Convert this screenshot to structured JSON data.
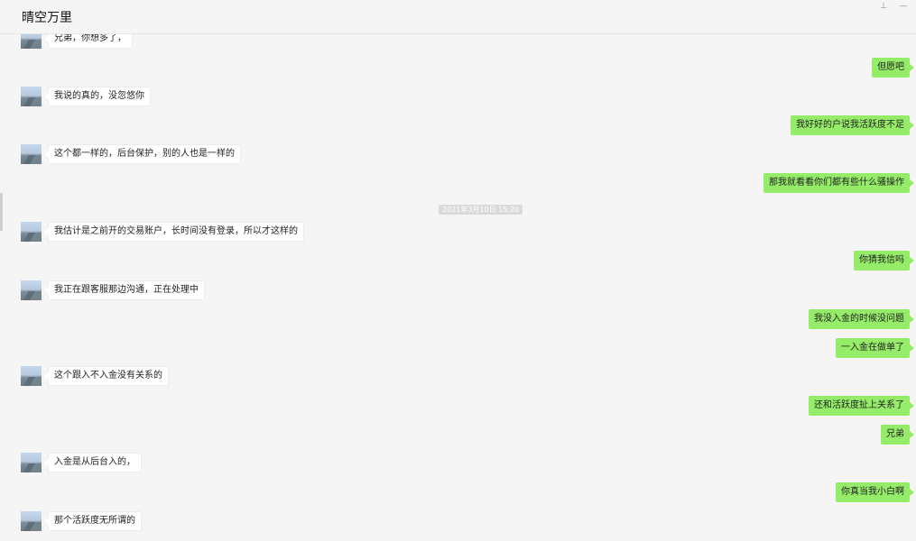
{
  "window": {
    "title": "晴空万里",
    "pin_icon": "pin-icon",
    "minimize_icon": "minimize-icon"
  },
  "chat": {
    "timestamp": "2021年3月10日 15:20",
    "messages": [
      {
        "side": "in",
        "text": "兄弟，你想多了，"
      },
      {
        "side": "out",
        "text": "但愿吧"
      },
      {
        "side": "in",
        "text": "我说的真的，没忽悠你"
      },
      {
        "side": "out",
        "text": "我好好的户说我活跃度不足"
      },
      {
        "side": "in",
        "text": "这个都一样的，后台保护，别的人也是一样的"
      },
      {
        "side": "out",
        "text": "那我就看看你们都有些什么骚操作"
      },
      {
        "side": "in",
        "text": "我估计是之前开的交易账户，长时间没有登录，所以才这样的"
      },
      {
        "side": "out",
        "text": "你猜我信吗"
      },
      {
        "side": "in",
        "text": "我正在跟客服那边沟通，正在处理中"
      },
      {
        "side": "out",
        "text": "我没入金的时候没问题"
      },
      {
        "side": "out",
        "text": "一入金在做单了"
      },
      {
        "side": "in",
        "text": "这个跟入不入金没有关系的"
      },
      {
        "side": "out",
        "text": "还和活跃度扯上关系了"
      },
      {
        "side": "out",
        "text": "兄弟"
      },
      {
        "side": "in",
        "text": "入金是从后台入的，"
      },
      {
        "side": "out",
        "text": "你真当我小白啊"
      },
      {
        "side": "in",
        "text": "那个活跃度无所谓的"
      }
    ]
  }
}
